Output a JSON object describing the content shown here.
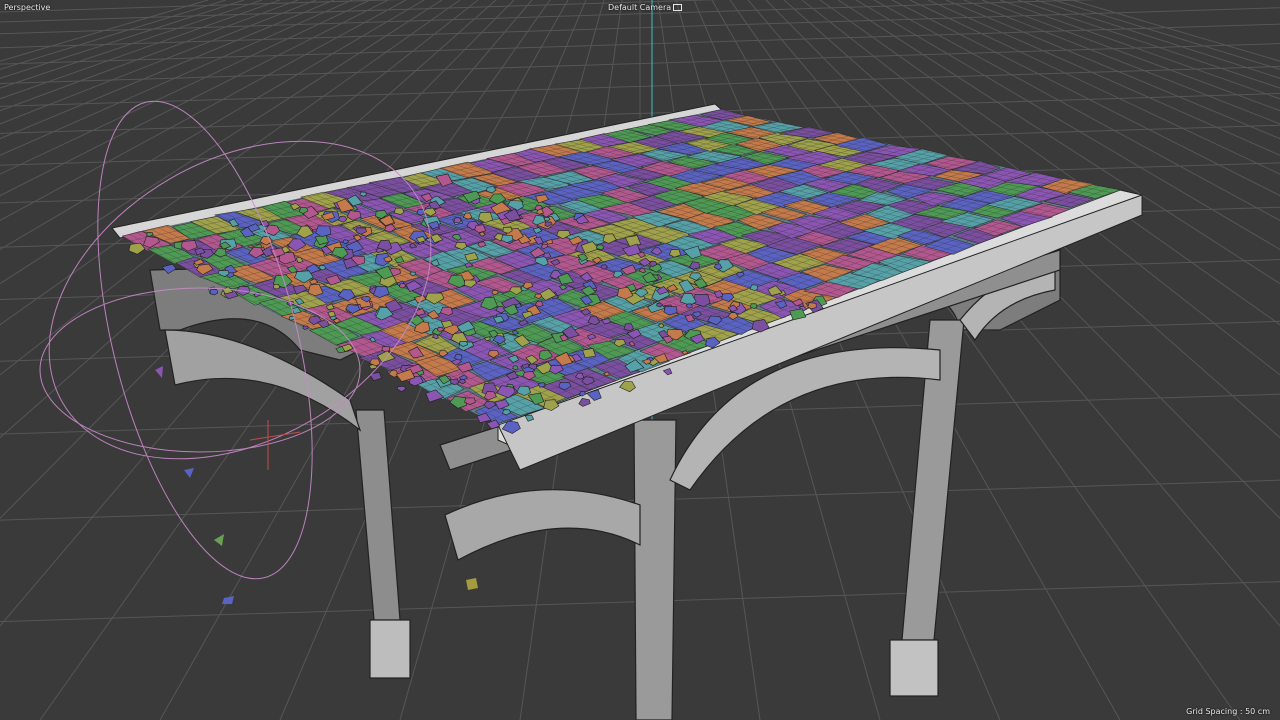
{
  "viewport": {
    "view_name": "Perspective",
    "camera_name": "Default Camera",
    "grid_label": "Grid Spacing : 50 cm",
    "background_color": "#3a3a3a",
    "grid_color": "#5a5a5a",
    "axis_color": "#3fbfbf",
    "gizmo_color": "#c98ac9"
  },
  "scene": {
    "object": "fractured bridge deck on arched steel supports",
    "fragment_colors": [
      "#8b56b3",
      "#4e9a55",
      "#5b63c2",
      "#c47a4a",
      "#b2588f",
      "#56a1a8",
      "#9fa14b",
      "#7a4fa0"
    ]
  }
}
